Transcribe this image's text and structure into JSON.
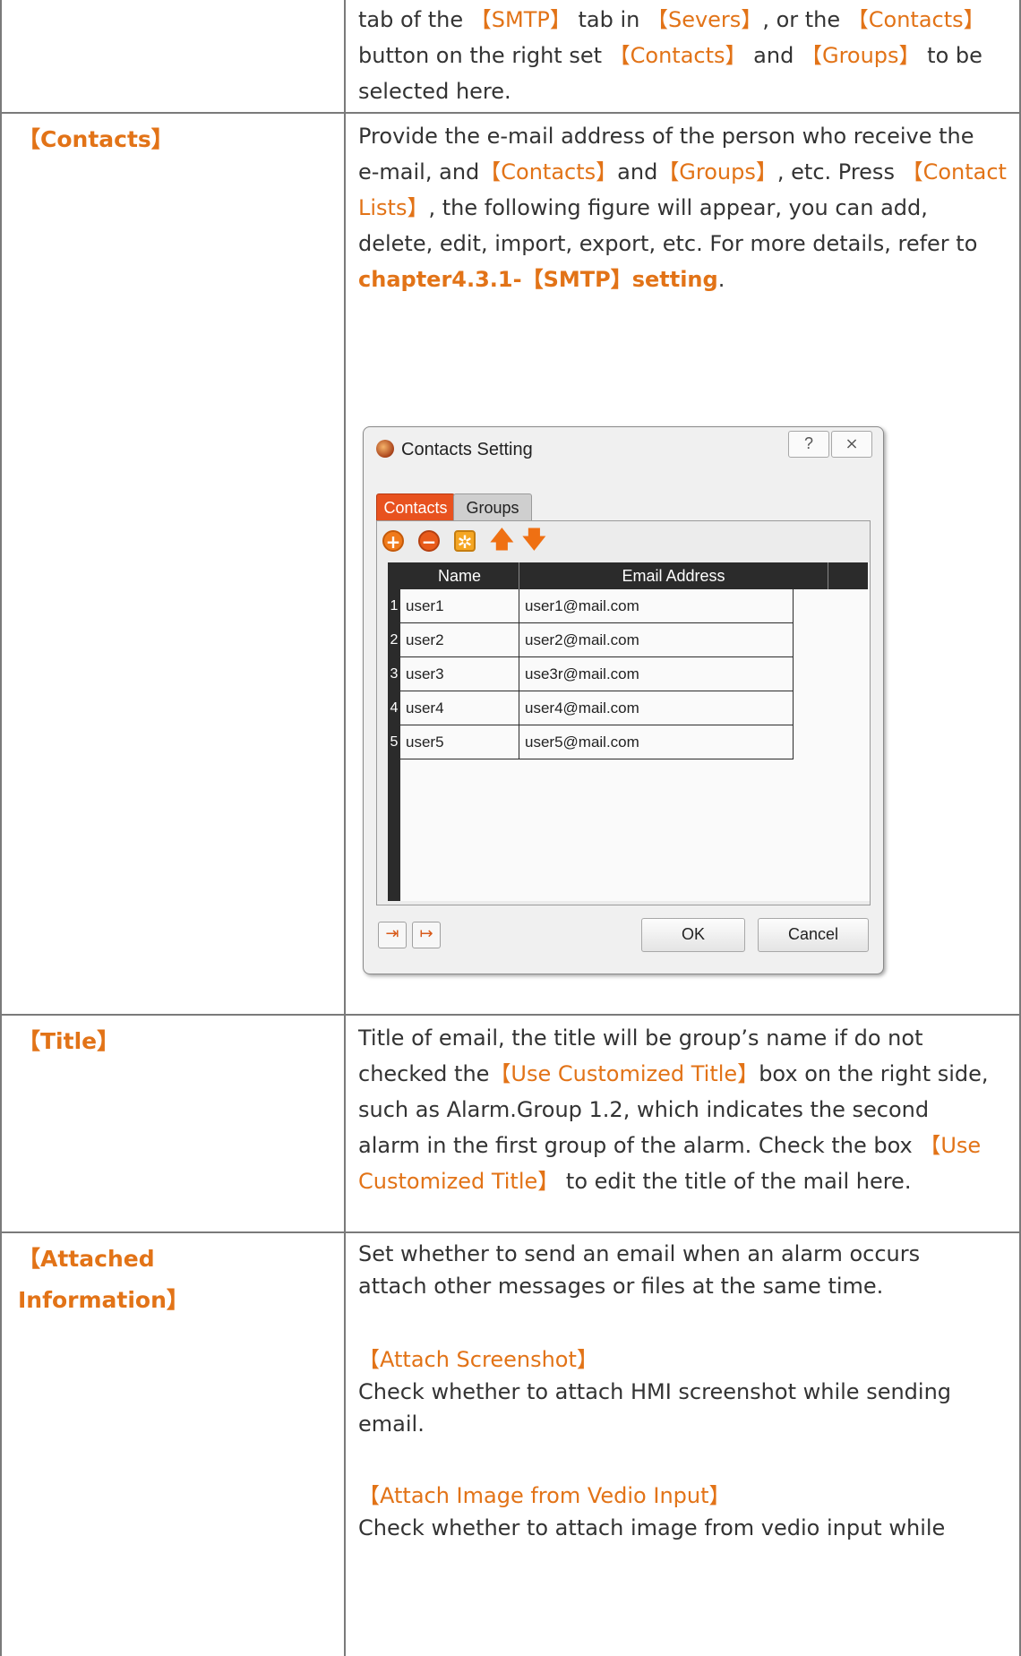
{
  "row_intro": {
    "lines": [
      [
        "tab of the ",
        "【SMTP】",
        " tab in ",
        "【Severs】",
        ", or the ",
        "【Contacts】"
      ],
      [
        "button on the right set ",
        "【Contacts】",
        " and ",
        "【Groups】",
        " to be"
      ],
      [
        "selected here."
      ]
    ]
  },
  "row_contacts": {
    "label": "【Contacts】",
    "desc": {
      "l1": "Provide the e-mail address of the person who receive the",
      "l2a": "e-mail, and",
      "l2b": "【Contacts】",
      "l2c": "and",
      "l2d": "【Groups】",
      "l2e": ", etc. Press ",
      "l2f": "【Contact",
      "l3a": "Lists】",
      "l3b": ", the following figure will appear, you can add,",
      "l4": "delete, edit, import, export, etc. For more details, refer to",
      "l5": "chapter4.3.1-【SMTP】setting",
      "l5_end": "."
    }
  },
  "dialog": {
    "title": "Contacts Setting",
    "help_btn": "?",
    "close_btn": "⨯",
    "tabs": [
      "Contacts",
      "Groups"
    ],
    "columns": [
      "Name",
      "Email Address"
    ],
    "rows": [
      {
        "num": "1",
        "name": "user1",
        "email": "user1@mail.com"
      },
      {
        "num": "2",
        "name": "user2",
        "email": "user2@mail.com"
      },
      {
        "num": "3",
        "name": "user3",
        "email": "use3r@mail.com"
      },
      {
        "num": "4",
        "name": "user4",
        "email": "user4@mail.com"
      },
      {
        "num": "5",
        "name": "user5",
        "email": "user5@mail.com"
      }
    ],
    "ok": "OK",
    "cancel": "Cancel"
  },
  "row_title": {
    "label": "【Title】",
    "l1": "Title of email, the title will be group’s name if do not",
    "l2a": "checked the",
    "l2b": "【Use Customized Title】",
    "l2c": "box on the right side,",
    "l3": "such as Alarm.Group 1.2, which indicates the second",
    "l4a": "alarm in the first group of the alarm. Check the box ",
    "l4b": "【Use",
    "l5a": "Customized Title】",
    "l5b": " to edit the title of the mail here."
  },
  "row_attached": {
    "label_l1": "【Attached",
    "label_l2": "Information】",
    "l1": "Set whether to send an email when an alarm occurs",
    "l2": "attach other messages or files at the same time.",
    "sub1_title": "【Attach Screenshot】",
    "sub1_l1": "Check whether to attach HMI screenshot while sending",
    "sub1_l2": "email.",
    "sub2_title": "【Attach Image from Vedio Input】",
    "sub2_l1": "Check whether to attach image from vedio input while"
  }
}
